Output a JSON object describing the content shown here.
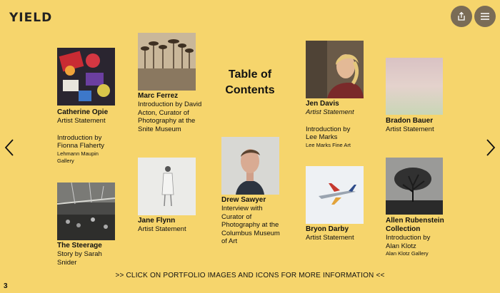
{
  "brand": {
    "logo": "YIELD"
  },
  "toc_title_line1": "Table of",
  "toc_title_line2": "Contents",
  "entries": {
    "opie": {
      "name": "Catherine Opie",
      "l1": "Artist Statement",
      "l2": "Introduction by",
      "l3": "Fionna Flaherty",
      "l4": "Lehmann Maupin",
      "l5": "Gallery"
    },
    "steerage": {
      "name": "The Steerage",
      "l1": "Story by Sarah",
      "l2": "Snider"
    },
    "ferrez": {
      "name": "Marc Ferrez",
      "l1": "Introduction by David",
      "l2": "Acton, Curator of",
      "l3": "Photography at the",
      "l4": "Snite Museum"
    },
    "flynn": {
      "name": "Jane Flynn",
      "l1": "Artist Statement"
    },
    "sawyer": {
      "name": "Drew Sawyer",
      "l1": "Interview with",
      "l2": "Curator of",
      "l3": "Photography at the",
      "l4": "Columbus Museum",
      "l5": "of Art"
    },
    "davis": {
      "name": "Jen Davis",
      "l1": "Artist Statement",
      "l2": "Introduction by",
      "l3": "Lee Marks",
      "l4": "Lee Marks Fine Art"
    },
    "darby": {
      "name": "Bryon Darby",
      "l1": "Artist Statement"
    },
    "bauer": {
      "name": "Bradon Bauer",
      "l1": "Artist Statement"
    },
    "rubenstein": {
      "name1": "Allen Rubenstein",
      "name2": "Collection",
      "l1": "Introduction by",
      "l2": "Alan Klotz",
      "l3": "Alan Klotz Gallery"
    }
  },
  "footer": ">> CLICK ON PORTFOLIO IMAGES AND ICONS FOR MORE INFORMATION <<",
  "page_number": "3",
  "icons": {
    "share": "share-icon",
    "menu": "menu-icon",
    "prev": "chevron-left-icon",
    "next": "chevron-right-icon"
  }
}
